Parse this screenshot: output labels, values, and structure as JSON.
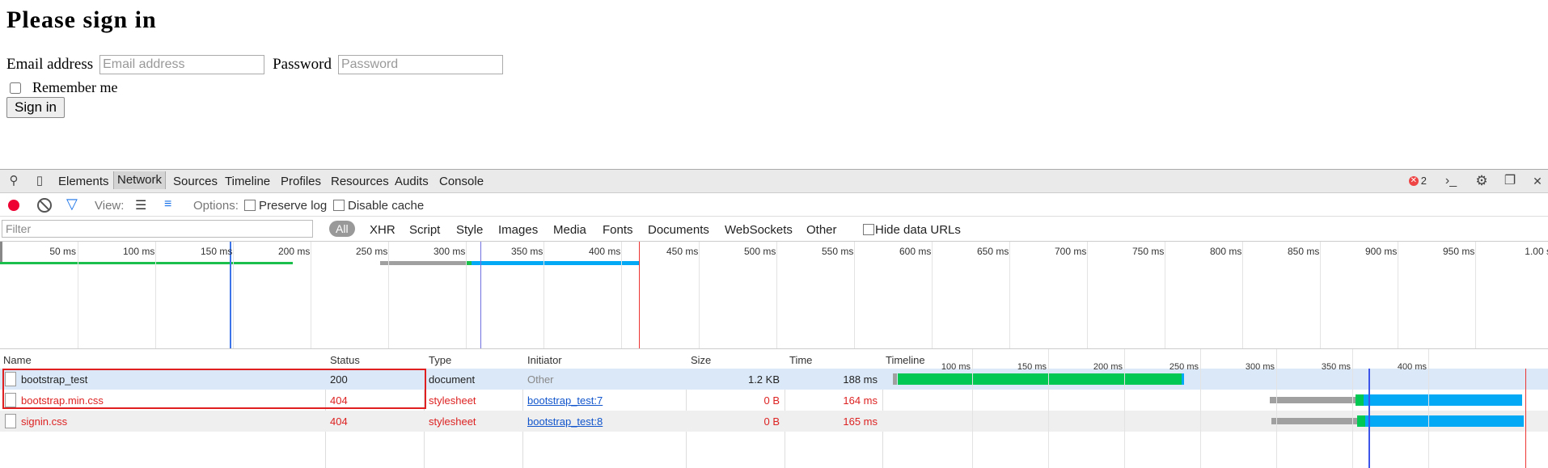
{
  "page": {
    "title": "Please sign in",
    "email_label": "Email address",
    "email_placeholder": "Email address",
    "password_label": "Password",
    "password_placeholder": "Password",
    "remember_label": "Remember me",
    "signin_label": "Sign in"
  },
  "devtools": {
    "tabs": [
      "Elements",
      "Network",
      "Sources",
      "Timeline",
      "Profiles",
      "Resources",
      "Audits",
      "Console"
    ],
    "active_tab": "Network",
    "error_count": "2",
    "toolbar": {
      "view_label": "View:",
      "options_label": "Options:",
      "preserve_log": "Preserve log",
      "disable_cache": "Disable cache"
    },
    "filter": {
      "placeholder": "Filter",
      "all": "All",
      "types": [
        "XHR",
        "Script",
        "Style",
        "Images",
        "Media",
        "Fonts",
        "Documents",
        "WebSockets",
        "Other"
      ],
      "hide_data_urls": "Hide data URLs"
    },
    "overview_ticks": [
      "50 ms",
      "100 ms",
      "150 ms",
      "200 ms",
      "250 ms",
      "300 ms",
      "350 ms",
      "400 ms",
      "450 ms",
      "500 ms",
      "550 ms",
      "600 ms",
      "650 ms",
      "700 ms",
      "750 ms",
      "800 ms",
      "850 ms",
      "900 ms",
      "950 ms",
      "1.00 s"
    ],
    "columns": [
      "Name",
      "Status",
      "Type",
      "Initiator",
      "Size",
      "Time",
      "Timeline"
    ],
    "timeline_ticks": [
      "100 ms",
      "150 ms",
      "200 ms",
      "250 ms",
      "300 ms",
      "350 ms",
      "400 ms"
    ],
    "requests": [
      {
        "name": "bootstrap_test",
        "status": "200",
        "type": "document",
        "initiator": "Other",
        "size": "1.2 KB",
        "time": "188 ms"
      },
      {
        "name": "bootstrap.min.css",
        "status": "404",
        "type": "stylesheet",
        "initiator": "bootstrap_test:7",
        "size": "0 B",
        "time": "164 ms"
      },
      {
        "name": "signin.css",
        "status": "404",
        "type": "stylesheet",
        "initiator": "bootstrap_test:8",
        "size": "0 B",
        "time": "165 ms"
      }
    ]
  },
  "colors": {
    "waiting": "#00c853",
    "receiving": "#03a9f4",
    "stalled": "#a0a0a0",
    "error": "#d22222",
    "highlight": "#e02020"
  }
}
